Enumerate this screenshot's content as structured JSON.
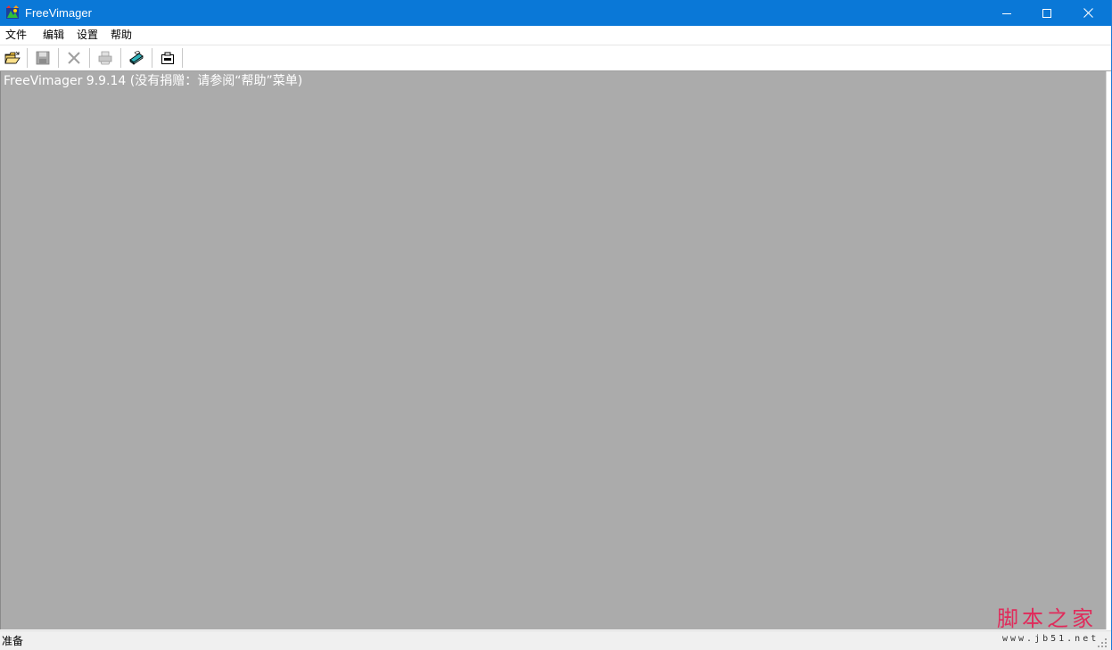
{
  "window": {
    "title": "FreeVimager"
  },
  "menu": {
    "items": [
      "文件",
      "编辑",
      "设置",
      "帮助"
    ]
  },
  "toolbar": {
    "buttons": [
      {
        "icon": "open-folder-icon",
        "enabled": true
      },
      {
        "icon": "save-disk-icon",
        "enabled": false
      },
      {
        "icon": "close-x-icon",
        "enabled": false
      },
      {
        "icon": "print-icon",
        "enabled": false
      },
      {
        "icon": "scan-icon",
        "enabled": true
      },
      {
        "icon": "screen-capture-icon",
        "enabled": true
      }
    ]
  },
  "client": {
    "message": "FreeVimager 9.9.14 (没有捐赠：请参阅“帮助”菜单)",
    "background": "#ababab"
  },
  "status": {
    "text": "准备"
  },
  "watermark": {
    "title": "脚本之家",
    "url": "www.jb51.net"
  },
  "colors": {
    "titlebar": "#0a78d7",
    "watermark": "#e02b5b"
  }
}
